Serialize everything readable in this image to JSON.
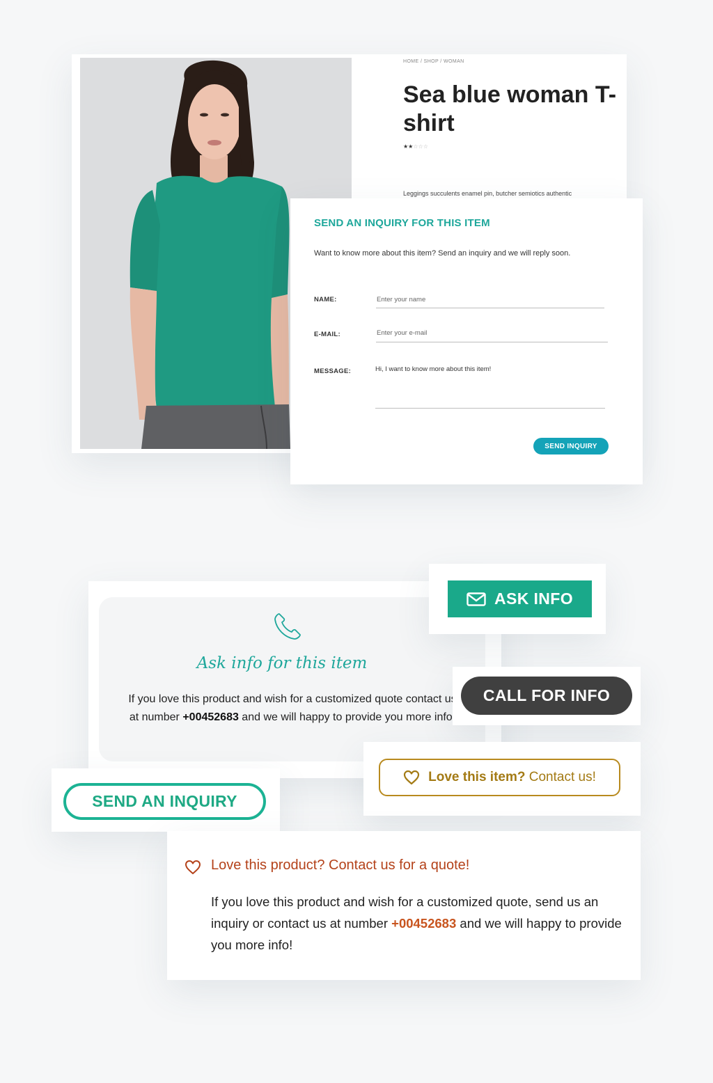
{
  "product": {
    "breadcrumb": "HOME / SHOP / WOMAN",
    "title": "Sea blue woman T-shirt",
    "rating": {
      "filled": 2,
      "total": 5
    },
    "description": "Leggings succulents enamel pin, butcher semiotics authentic"
  },
  "inquiry_form": {
    "title": "SEND AN INQUIRY FOR THIS ITEM",
    "intro": "Want to know more about this item? Send an inquiry and we will reply soon.",
    "name_label": "NAME:",
    "name_placeholder": "Enter your name",
    "email_label": "E-MAIL:",
    "email_placeholder": "Enter your e-mail",
    "message_label": "MESSAGE:",
    "message_value": "Hi, I want to know more about this item!",
    "submit_label": "SEND INQUIRY",
    "accent": "#1ea79b",
    "button_color": "#14a3b8"
  },
  "ask_info_box": {
    "title": "Ask info for this item",
    "text_before": "If you love this product and wish for a customized quote contact us at number ",
    "phone": "+00452683",
    "text_after": " and we will happy to provide you more info!"
  },
  "buttons": {
    "ask_info": "ASK INFO",
    "call_for_info": "CALL FOR INFO",
    "love_strong": "Love this item?",
    "love_rest": " Contact us!",
    "send_an_inquiry": "SEND AN INQUIRY",
    "ask_info_color": "#1aa98a",
    "call_color": "#404040",
    "love_color": "#b88a1e"
  },
  "quote_card": {
    "title": "Love this product? Contact us for a quote!",
    "text_before": "If you love this product and wish for a customized quote, send us an inquiry or contact us at number ",
    "phone": "+00452683",
    "text_after": " and we will happy to provide you more info!",
    "accent": "#b4421a"
  },
  "icons": [
    "phone-icon",
    "mail-icon",
    "heart-icon"
  ]
}
